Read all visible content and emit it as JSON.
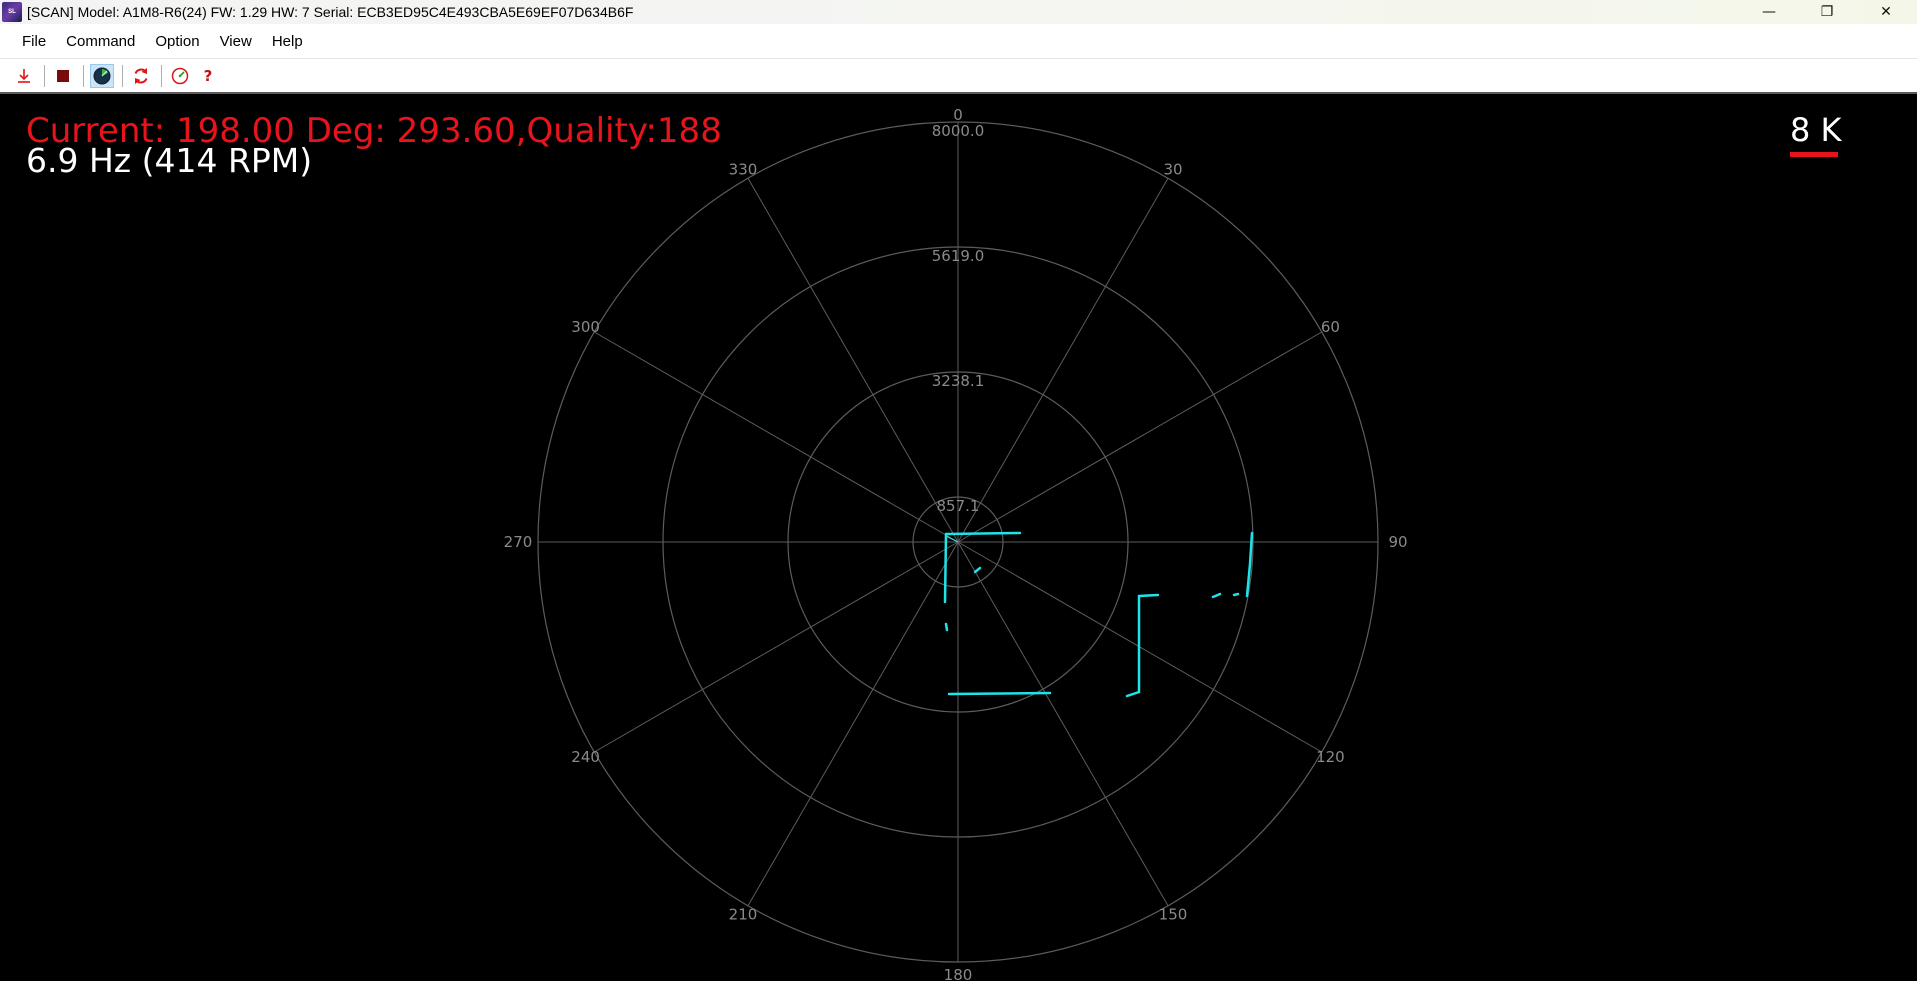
{
  "window": {
    "title": "[SCAN] Model: A1M8-R6(24) FW: 1.29 HW: 7 Serial: ECB3ED95C4E493CBA5E69EF07D634B6F",
    "icon_name": "app-logo-icon",
    "controls": {
      "minimize": "—",
      "maximize": "❐",
      "close": "✕"
    }
  },
  "menu": {
    "items": [
      "File",
      "Command",
      "Option",
      "View",
      "Help"
    ]
  },
  "toolbar": {
    "buttons": [
      {
        "name": "download-icon",
        "active": false
      },
      {
        "name": "stop-icon",
        "active": false
      },
      {
        "name": "radar-view-icon",
        "active": true
      },
      {
        "name": "refresh-icon",
        "active": false
      },
      {
        "name": "gauge-icon",
        "active": false
      },
      {
        "name": "help-icon",
        "active": false
      }
    ],
    "help_glyph": "?"
  },
  "scan": {
    "current_text": "Current: 198.00 Deg: 293.60,Quality:188",
    "rate_text": "6.9 Hz (414 RPM)",
    "range_text": "8 K",
    "ring_labels": [
      "8000.0",
      "5619.0",
      "3238.1",
      "857.1"
    ],
    "angle_labels": [
      "0",
      "30",
      "60",
      "90",
      "120",
      "150",
      "180",
      "210",
      "240",
      "270",
      "300",
      "330"
    ],
    "colors": {
      "background": "#000000",
      "grid": "#5c5c5c",
      "points": "#1ee3e8",
      "current_text": "#e8141c",
      "rate_text": "#ffffff",
      "range_underline": "#e8141c"
    }
  }
}
